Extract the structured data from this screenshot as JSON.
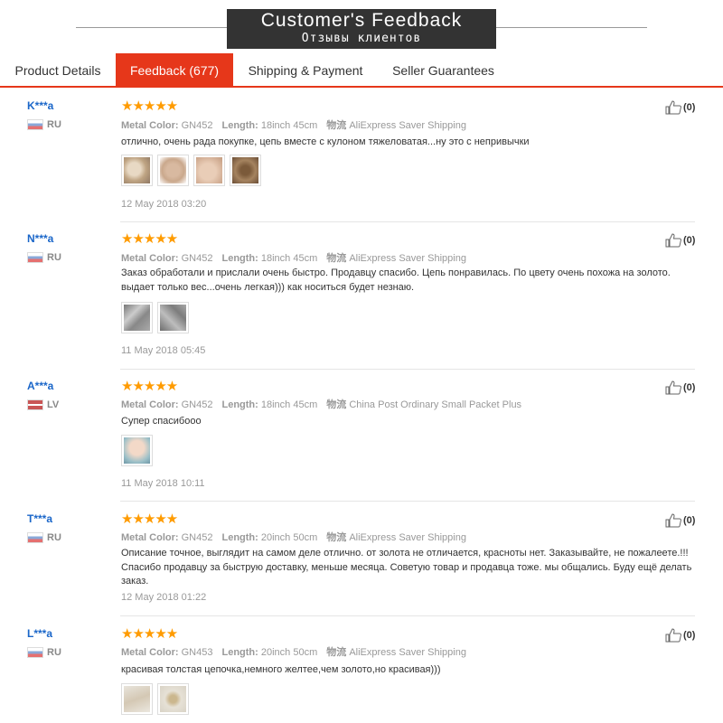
{
  "banner": {
    "title": "Customer's Feedback",
    "subtitle": "Отзывы клиентов"
  },
  "tabs": [
    {
      "label": "Product Details",
      "active": false
    },
    {
      "label": "Feedback (677)",
      "active": true
    },
    {
      "label": "Shipping & Payment",
      "active": false
    },
    {
      "label": "Seller Guarantees",
      "active": false
    }
  ],
  "colors": {
    "accent": "#e6371a",
    "link": "#1a66c9",
    "star": "#ff9b00"
  },
  "labels": {
    "metal_color": "Metal Color:",
    "length": "Length:",
    "shipping": "物流"
  },
  "reviews": [
    {
      "user": "K***a",
      "country": "RU",
      "flag": "ru",
      "rating": 5,
      "stars": "★★★★★",
      "metal_color": "GN452",
      "length": "18inch 45cm",
      "shipping": "AliExpress Saver Shipping",
      "text": "отлично, очень рада покупке, цепь вместе с кулоном тяжеловатая...ну это с непривычки",
      "photos": [
        "photo-chain-in-hand",
        "photo-pendant-on-palm",
        "photo-pendant-on-skin",
        "photo-pendant-close-up"
      ],
      "date": "12 May 2018 03:20",
      "likes": "(0)"
    },
    {
      "user": "N***a",
      "country": "RU",
      "flag": "ru",
      "rating": 5,
      "stars": "★★★★★",
      "metal_color": "GN452",
      "length": "18inch 45cm",
      "shipping": "AliExpress Saver Shipping",
      "text": "Заказ обработали и прислали очень быстро. Продавцу спасибо. Цепь понравилась. По цвету очень похожа на золото. выдает только вес...очень легкая))) как носиться будет незнаю.",
      "photos": [
        "photo-chain-flat",
        "photo-chain-detail"
      ],
      "date": "11 May 2018 05:45",
      "likes": "(0)"
    },
    {
      "user": "A***a",
      "country": "LV",
      "flag": "lv",
      "rating": 5,
      "stars": "★★★★★",
      "metal_color": "GN452",
      "length": "18inch 45cm",
      "shipping": "China Post Ordinary Small Packet Plus",
      "text": "Супер спасибооо",
      "photos": [
        "photo-chain-worn"
      ],
      "date": "11 May 2018 10:11",
      "likes": "(0)"
    },
    {
      "user": "T***a",
      "country": "RU",
      "flag": "ru",
      "rating": 5,
      "stars": "★★★★★",
      "metal_color": "GN452",
      "length": "20inch 50cm",
      "shipping": "AliExpress Saver Shipping",
      "text": "Описание точное, выглядит на самом деле отлично. от золота не отличается, красноты нет. Заказывайте, не пожалеете.!!! Спасибо продавцу за быструю доставку, меньше месяца. Советую товар и продавца тоже. мы общались. Буду ещё делать заказ.",
      "photos": [],
      "date": "12 May 2018 01:22",
      "likes": "(0)"
    },
    {
      "user": "L***a",
      "country": "RU",
      "flag": "ru",
      "rating": 5,
      "stars": "★★★★★",
      "metal_color": "GN453",
      "length": "20inch 50cm",
      "shipping": "AliExpress Saver Shipping",
      "text": "красивая толстая цепочка,немного желтее,чем золото,но красивая)))",
      "photos": [
        "photo-chain-on-paper",
        "photo-chain-coiled"
      ],
      "date": "",
      "likes": "(0)"
    }
  ]
}
